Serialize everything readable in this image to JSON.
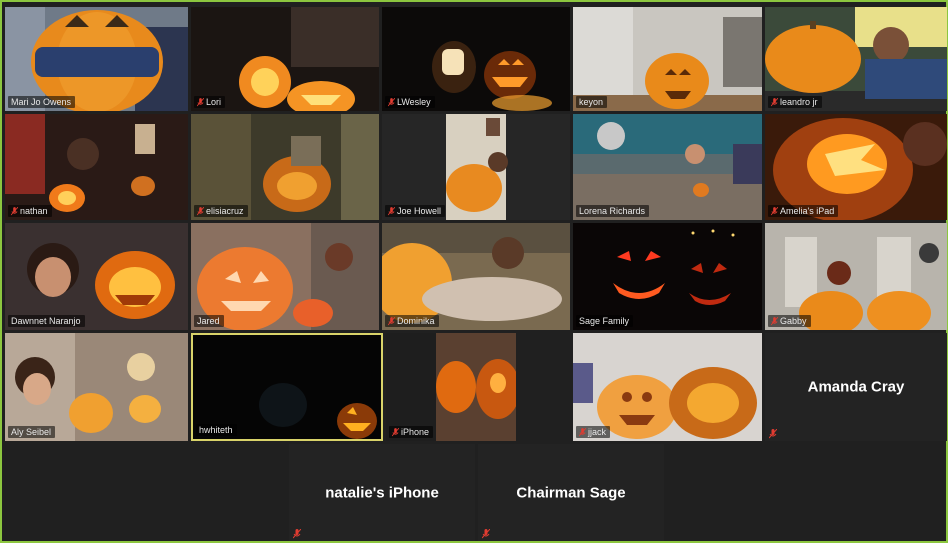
{
  "participants": [
    {
      "name": "Mari Jo Owens",
      "muted": false
    },
    {
      "name": "Lori",
      "muted": true
    },
    {
      "name": "LWesley",
      "muted": true
    },
    {
      "name": "keyon",
      "muted": false
    },
    {
      "name": "leandro jr",
      "muted": true
    },
    {
      "name": "nathan",
      "muted": true
    },
    {
      "name": "elisiacruz",
      "muted": true
    },
    {
      "name": "Joe Howell",
      "muted": true
    },
    {
      "name": "Lorena Richards",
      "muted": false
    },
    {
      "name": "Amelia's iPad",
      "muted": true
    },
    {
      "name": "Dawnnet Naranjo",
      "muted": false
    },
    {
      "name": "Jared",
      "muted": false
    },
    {
      "name": "Dominika",
      "muted": true
    },
    {
      "name": "Sage Family",
      "muted": false
    },
    {
      "name": "Gabby",
      "muted": true
    },
    {
      "name": "Aly Seibel",
      "muted": false
    },
    {
      "name": "hwhiteth",
      "muted": false
    },
    {
      "name": "iPhone",
      "muted": true
    },
    {
      "name": "jjack",
      "muted": true
    },
    {
      "name": "Amanda Cray",
      "muted": true
    },
    {
      "name": "natalie's iPhone",
      "muted": true
    },
    {
      "name": "Chairman Sage",
      "muted": true
    }
  ],
  "colors": {
    "active_speaker_border": "#d9d36a",
    "window_border": "#8cc63f",
    "muted_mic": "#e03c31"
  }
}
